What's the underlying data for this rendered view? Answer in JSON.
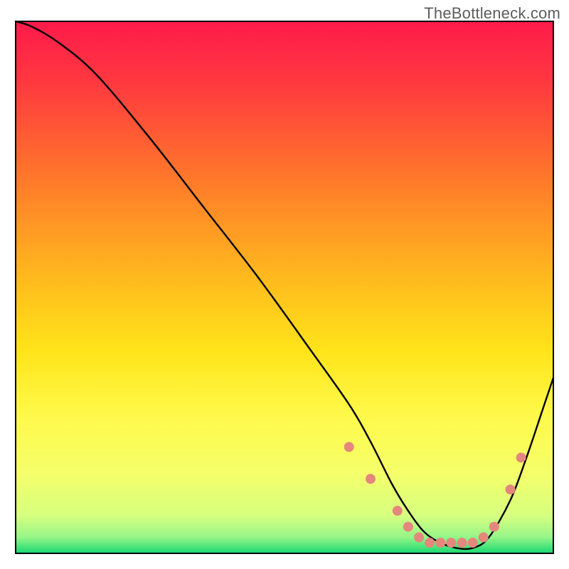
{
  "watermark": "TheBottleneck.com",
  "chart_data": {
    "type": "line",
    "title": "",
    "xlabel": "",
    "ylabel": "",
    "xlim": [
      0,
      100
    ],
    "ylim": [
      0,
      100
    ],
    "grid": false,
    "background_gradient": {
      "top_color": "#ff1a4b",
      "mid_colors": [
        "#ff7a2a",
        "#ffd91a",
        "#fff94a",
        "#e9ff7a"
      ],
      "bottom_color": "#17d872"
    },
    "series": [
      {
        "name": "bottleneck-curve",
        "color": "#000000",
        "x": [
          0,
          3,
          8,
          15,
          25,
          35,
          45,
          55,
          62,
          66,
          70,
          73,
          76,
          79,
          82,
          85,
          88,
          92,
          95,
          98,
          100
        ],
        "y": [
          100,
          99,
          96,
          90,
          78,
          65,
          52,
          38,
          28,
          21,
          13,
          8,
          4,
          2,
          1,
          1,
          3,
          10,
          18,
          27,
          33
        ]
      },
      {
        "name": "marker-dots",
        "color": "#e4877d",
        "type": "scatter",
        "x": [
          62,
          66,
          71,
          73,
          75,
          77,
          79,
          81,
          83,
          85,
          87,
          89,
          92,
          94
        ],
        "y": [
          20,
          14,
          8,
          5,
          3,
          2,
          2,
          2,
          2,
          2,
          3,
          5,
          12,
          18
        ]
      }
    ]
  }
}
